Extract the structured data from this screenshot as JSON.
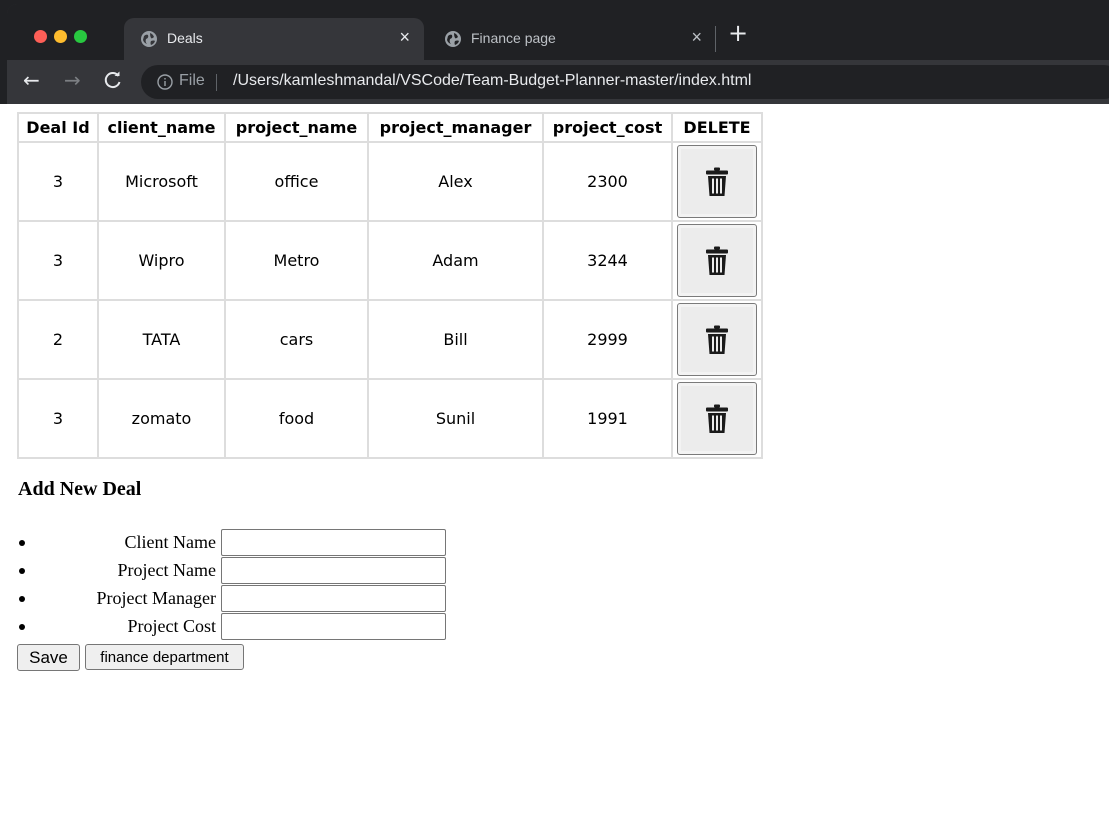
{
  "browser": {
    "tabs": [
      {
        "title": "Deals",
        "active": true
      },
      {
        "title": "Finance page",
        "active": false
      }
    ],
    "address": {
      "scheme": "File",
      "url": "/Users/kamleshmandal/VSCode/Team-Budget-Planner-master/index.html"
    },
    "icons": {
      "back": "←",
      "forward": "→",
      "reload": "C",
      "close": "×",
      "new_tab": "+"
    }
  },
  "table": {
    "headers": [
      "Deal Id",
      "client_name",
      "project_name",
      "project_manager",
      "project_cost",
      "DELETE"
    ],
    "rows": [
      {
        "id": "3",
        "client": "Microsoft",
        "project": "office",
        "manager": "Alex",
        "cost": "2300"
      },
      {
        "id": "3",
        "client": "Wipro",
        "project": "Metro",
        "manager": "Adam",
        "cost": "3244"
      },
      {
        "id": "2",
        "client": "TATA",
        "project": "cars",
        "manager": "Bill",
        "cost": "2999"
      },
      {
        "id": "3",
        "client": "zomato",
        "project": "food",
        "manager": "Sunil",
        "cost": "1991"
      }
    ]
  },
  "form": {
    "title": "Add New Deal",
    "fields": [
      {
        "label": "Client Name",
        "value": ""
      },
      {
        "label": "Project Name",
        "value": ""
      },
      {
        "label": "Project Manager",
        "value": ""
      },
      {
        "label": "Project Cost",
        "value": ""
      }
    ],
    "save_label": "Save",
    "finance_label": "finance department"
  }
}
